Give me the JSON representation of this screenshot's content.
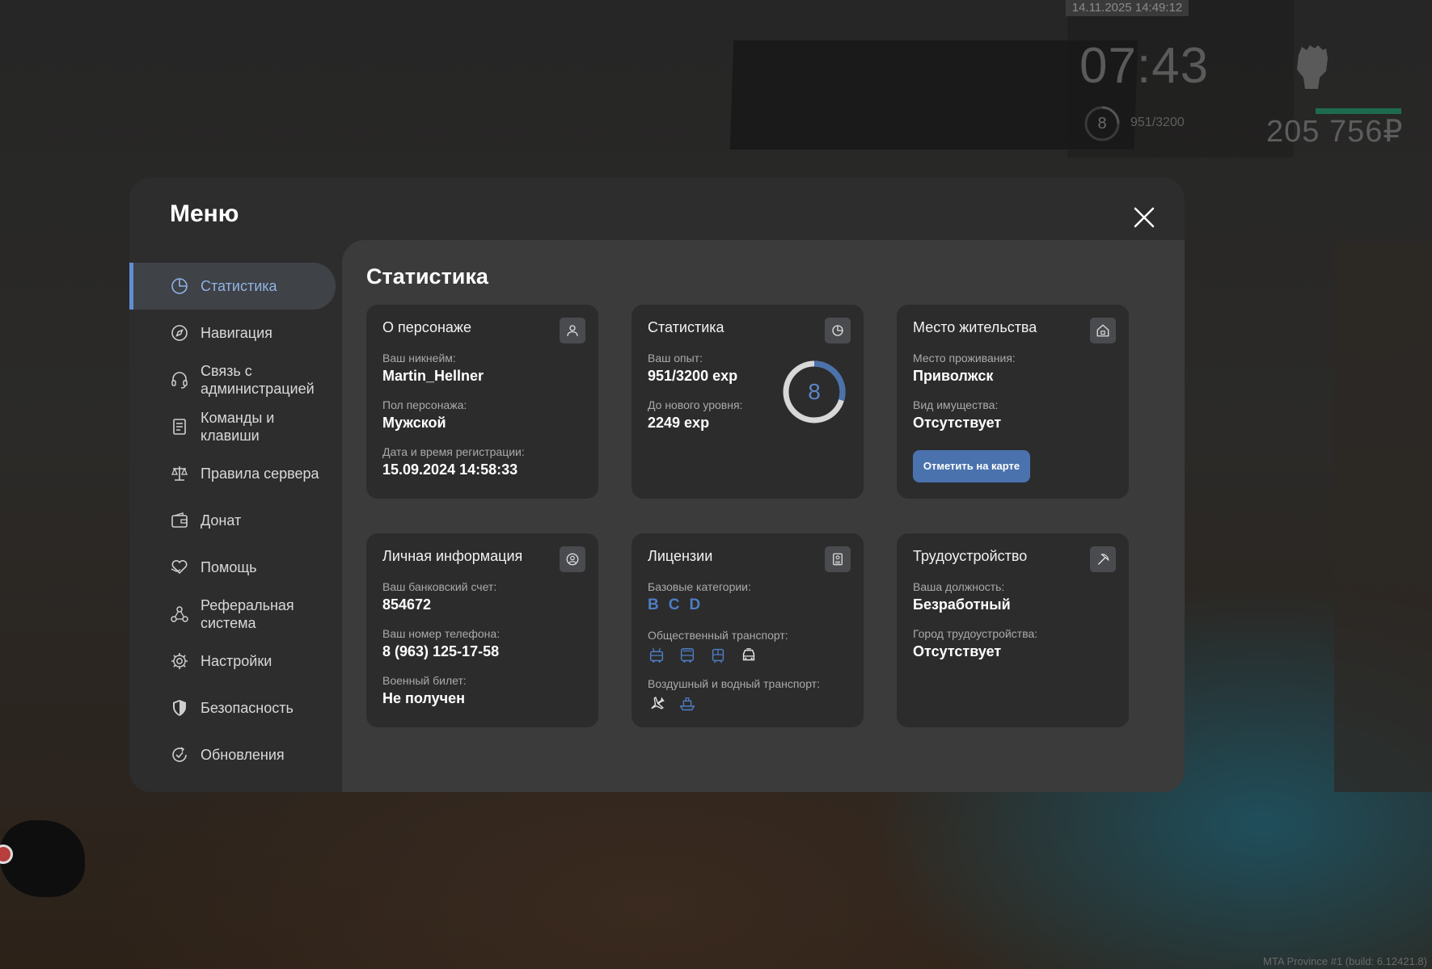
{
  "hud": {
    "timestamp": "14.11.2025 14:49:12",
    "clock": "07:43",
    "level": "8",
    "exp": "951/3200",
    "money": "205 756₽",
    "build": "MTA Province #1 (build: 6.12421.8)"
  },
  "menu": {
    "title": "Меню",
    "close_icon": "close-icon"
  },
  "sidebar": {
    "items": [
      {
        "label": "Статистика",
        "icon": "pie-chart-icon",
        "active": true
      },
      {
        "label": "Навигация",
        "icon": "compass-icon"
      },
      {
        "label": "Связь с\nадминистрацией",
        "icon": "headset-icon"
      },
      {
        "label": "Команды и\nклавиши",
        "icon": "document-icon"
      },
      {
        "label": "Правила сервера",
        "icon": "scales-icon"
      },
      {
        "label": "Донат",
        "icon": "wallet-icon"
      },
      {
        "label": "Помощь",
        "icon": "heart-hand-icon"
      },
      {
        "label": "Реферальная\nсистема",
        "icon": "referral-icon"
      },
      {
        "label": "Настройки",
        "icon": "gear-icon"
      },
      {
        "label": "Безопасность",
        "icon": "shield-icon"
      },
      {
        "label": "Обновления",
        "icon": "refresh-check-icon"
      }
    ]
  },
  "content": {
    "title": "Статистика",
    "character": {
      "title": "О персонаже",
      "icon": "user-icon",
      "nickname_label": "Ваш никнейм:",
      "nickname": "Martin_Hellner",
      "gender_label": "Пол персонажа:",
      "gender": "Мужской",
      "reg_label": "Дата и время регистрации:",
      "reg": "15.09.2024 14:58:33"
    },
    "stats": {
      "title": "Статистика",
      "icon": "pie-chart-icon",
      "exp_label": "Ваш опыт:",
      "exp": "951/3200 exp",
      "next_label": "До нового уровня:",
      "next": "2249 exp",
      "level": "8",
      "progress": 0.297
    },
    "residence": {
      "title": "Место жительства",
      "icon": "house-icon",
      "place_label": "Место проживания:",
      "place": "Приволжск",
      "property_label": "Вид имущества:",
      "property": "Отсутствует",
      "map_button": "Отметить на карте"
    },
    "personal": {
      "title": "Личная информация",
      "icon": "id-user-icon",
      "bank_label": "Ваш банковский счет:",
      "bank": "854672",
      "phone_label": "Ваш номер телефона:",
      "phone": "8 (963) 125-17-58",
      "military_label": "Военный билет:",
      "military": "Не получен"
    },
    "licenses": {
      "title": "Лицензии",
      "icon": "badge-icon",
      "base_label": "Базовые категории:",
      "categories": [
        "B",
        "C",
        "D"
      ],
      "public_label": "Общественный транспорт:",
      "air_label": "Воздушный и водный транспорт:"
    },
    "employment": {
      "title": "Трудоустройство",
      "icon": "pickaxe-icon",
      "position_label": "Ваша должность:",
      "position": "Безработный",
      "city_label": "Город трудоустройства:",
      "city": "Отсутствует"
    }
  },
  "colors": {
    "accent": "#5f8ed6",
    "button": "#4a72ad",
    "panel": "#2d2d2e",
    "card": "#2c2c2d"
  }
}
